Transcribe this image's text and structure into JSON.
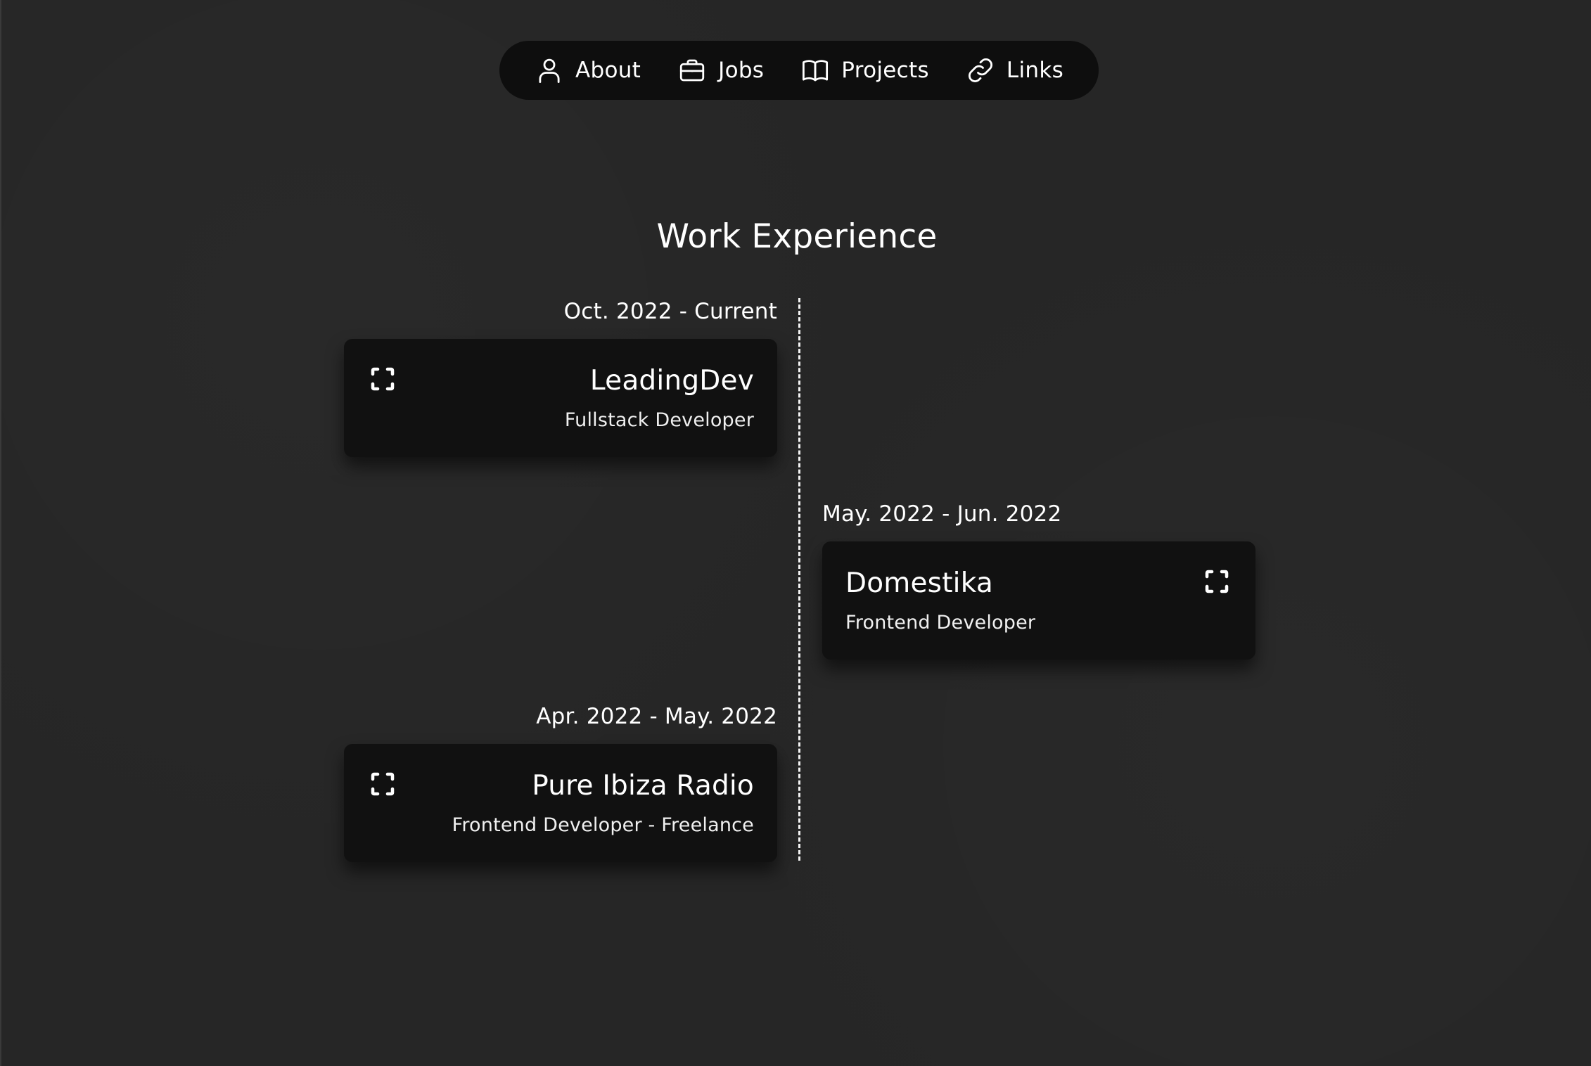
{
  "nav": {
    "items": [
      {
        "label": "About",
        "icon": "user-icon"
      },
      {
        "label": "Jobs",
        "icon": "briefcase-icon"
      },
      {
        "label": "Projects",
        "icon": "book-icon"
      },
      {
        "label": "Links",
        "icon": "link-icon"
      }
    ]
  },
  "section": {
    "title": "Work Experience"
  },
  "jobs": [
    {
      "date": "Oct. 2022 - Current",
      "company": "LeadingDev",
      "role": "Fullstack Developer",
      "side": "left",
      "icon": "expand-icon"
    },
    {
      "date": "May. 2022 - Jun. 2022",
      "company": "Domestika",
      "role": "Frontend Developer",
      "side": "right",
      "icon": "expand-icon"
    },
    {
      "date": "Apr. 2022 - May. 2022",
      "company": "Pure Ibiza Radio",
      "role": "Frontend Developer - Freelance",
      "side": "left",
      "icon": "expand-icon"
    }
  ],
  "colors": {
    "background": "#262626",
    "nav_background": "#0e0e0e",
    "card_background": "#111111",
    "text": "#ffffff"
  }
}
